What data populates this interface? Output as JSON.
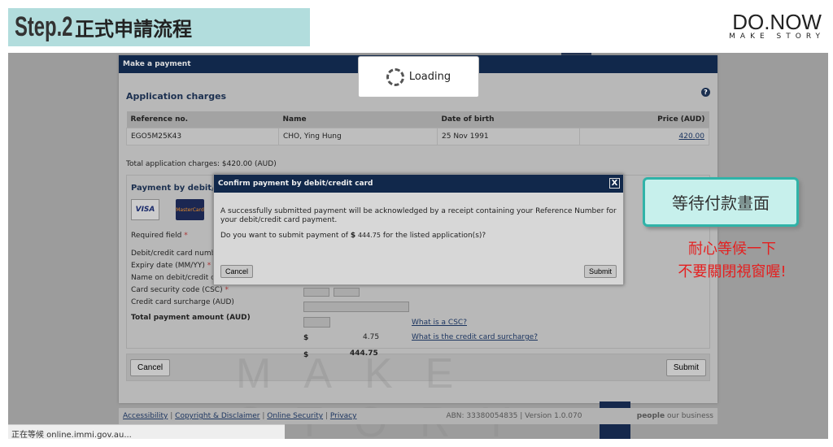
{
  "slide": {
    "step": "Step.2",
    "title": "正式申請流程",
    "logo_main": "DO.NOW",
    "logo_sub": "MAKE STORY",
    "callout": "等待付款畫面",
    "note_line1": "耐心等候一下",
    "note_line2": "不要關閉視窗喔!",
    "watermark_sub": "MAKE STORY"
  },
  "page": {
    "header": "Make a payment",
    "section": "Application charges",
    "help_icon": "question-circle-icon",
    "table": {
      "headers": [
        "Reference no.",
        "Name",
        "Date of birth",
        "Price (AUD)"
      ],
      "rows": [
        [
          "EGO5M25K43",
          "CHO, Ying Hung",
          "25 Nov 1991",
          "420.00"
        ]
      ]
    },
    "total_charges": "Total application charges: $420.00 (AUD)",
    "payment_heading": "Payment by debit/cr",
    "cards": [
      "VISA",
      "MasterCard"
    ],
    "required": "Required field",
    "asterisk": "*",
    "fields": {
      "card_number": "Debit/credit card numbe",
      "expiry": "Expiry date (MM/YY)",
      "name": "Name on debit/credit card",
      "csc": "Card security code (CSC)",
      "surcharge": "Credit card surcharge (AUD)",
      "total": "Total payment amount (AUD)"
    },
    "currency": "$",
    "surcharge_value": "4.75",
    "total_value": "444.75",
    "csc_link": "What is a CSC?",
    "surcharge_link": "What is the credit card surcharge?",
    "cancel": "Cancel",
    "submit": "Submit"
  },
  "loading": "Loading",
  "modal": {
    "title": "Confirm payment by debit/credit card",
    "close": "X",
    "message": "A successfully submitted payment will be acknowledged by a receipt containing your Reference Number for your debit/credit card payment.",
    "question_pre": "Do you want to submit payment of",
    "currency": "$",
    "amount": "444.75",
    "question_post": "for the listed application(s)?",
    "cancel": "Cancel",
    "submit": "Submit"
  },
  "footer": {
    "links": [
      "Accessibility",
      "Copyright & Disclaimer",
      "Online Security",
      "Privacy"
    ],
    "abn": "ABN: 33380054835 | Version 1.0.070",
    "tagline_bold": "people",
    "tagline": "our business"
  },
  "status_bar": "正在等候 online.immi.gov.au..."
}
